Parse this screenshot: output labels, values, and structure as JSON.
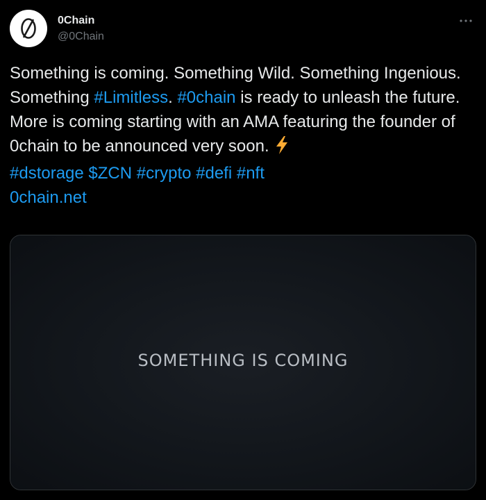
{
  "author": {
    "display_name": "0Chain",
    "handle": "@0Chain",
    "avatar_icon": "zero-slash-logo-icon"
  },
  "menu": {
    "more_icon": "more-horizontal-icon"
  },
  "tweet": {
    "segments": {
      "s1": "Something is coming. Something Wild. Something Ingenious. Something ",
      "tag_limitless": "#Limitless",
      "s2": ". ",
      "tag_0chain": "#0chain",
      "s3": " is ready to unleash the future. More is coming starting with an AMA featuring the founder of 0chain to be announced very soon. ",
      "bolt_icon": "lightning-bolt-icon",
      "nl1": "\n",
      "tag_dstorage": "#dstorage",
      "sp1": " ",
      "cash_zcn": "$ZCN",
      "sp2": " ",
      "tag_crypto": "#crypto",
      "sp3": " ",
      "tag_defi": "#defi",
      "sp4": " ",
      "tag_nft": "#nft",
      "nl2": "\n",
      "url": "0chain.net"
    }
  },
  "media": {
    "caption": "SOMETHING IS COMING"
  },
  "colors": {
    "background": "#000000",
    "text": "#e7e9ea",
    "secondary_text": "#71767b",
    "link": "#1d9bf0",
    "media_border": "#2f3336",
    "media_caption": "#b9bec4",
    "bolt": "#ffac33"
  }
}
